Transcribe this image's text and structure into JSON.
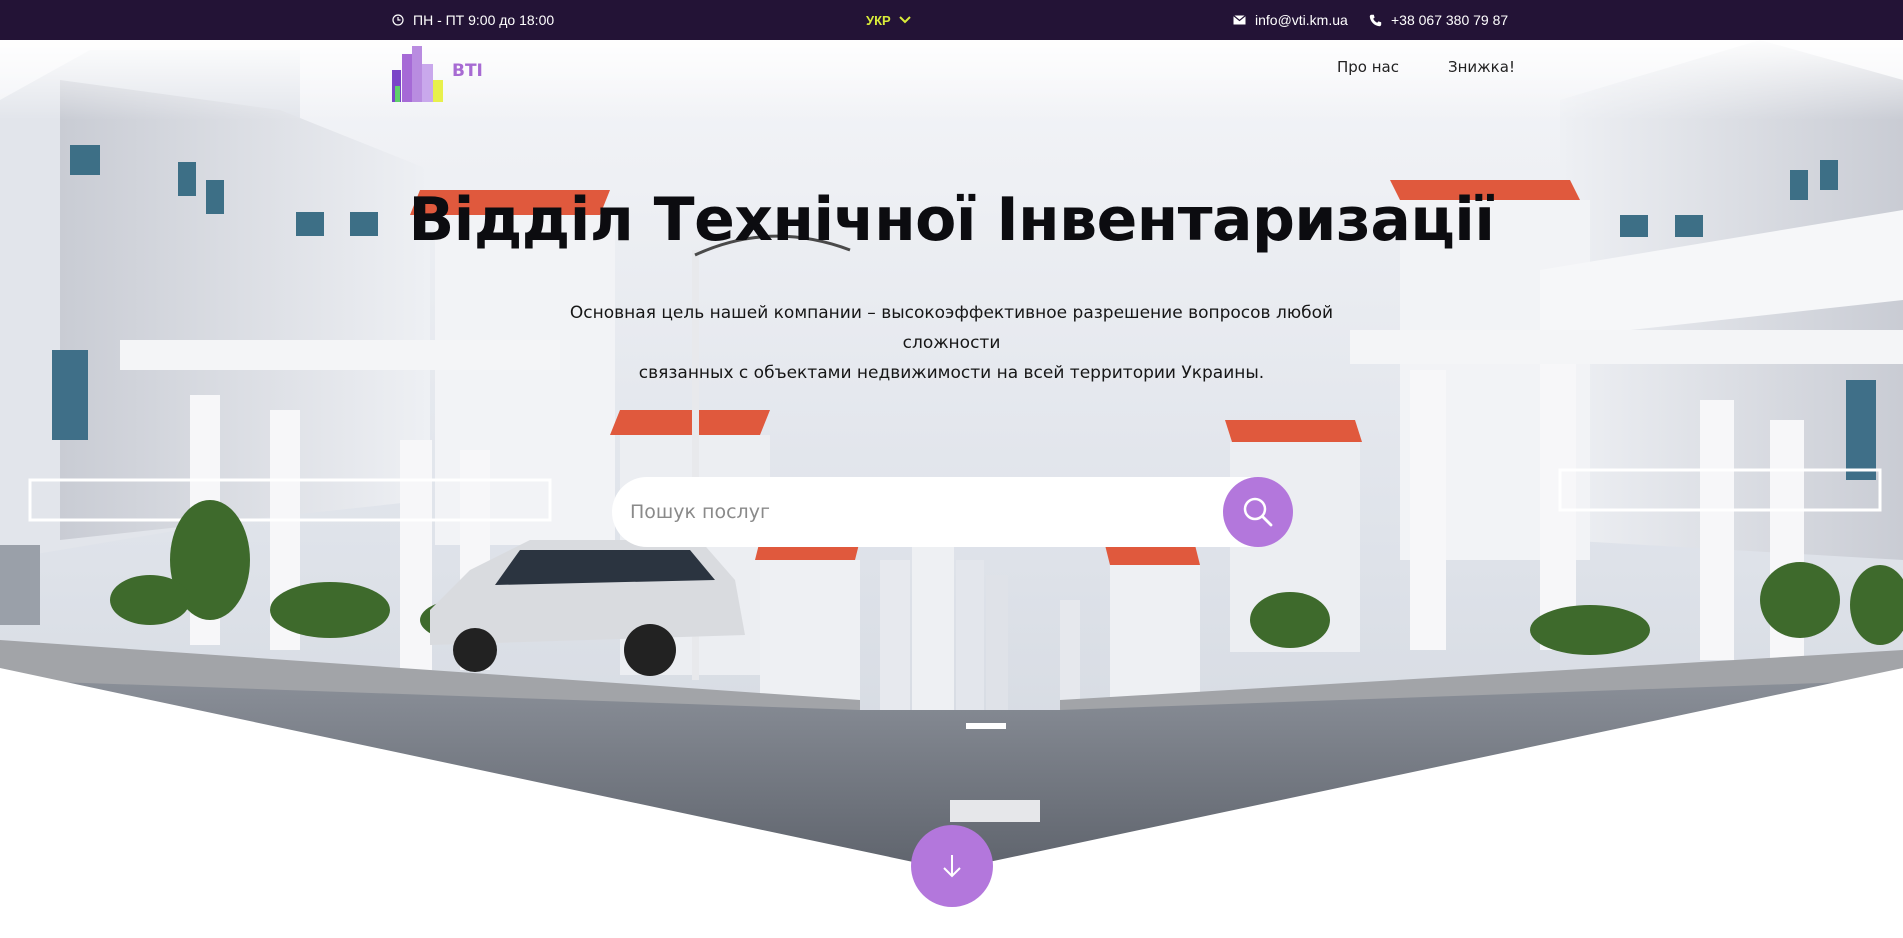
{
  "topbar": {
    "hours": "ПН - ПТ 9:00 до 18:00",
    "language": "УКР",
    "email": "info@vti.km.ua",
    "phone": "+38 067 380 79 87"
  },
  "header": {
    "logo_text": "BTI",
    "nav": [
      "Про нас",
      "Знижка!"
    ]
  },
  "hero": {
    "title": "Відділ Технічної Інвентаризації",
    "subtitle_line1": "Основная цель нашей компании – высокоэффективное разрешение вопросов любой сложности",
    "subtitle_line2": "связанных с объектами недвижимости на всей территории Украины."
  },
  "search": {
    "placeholder": "Пошук послуг"
  },
  "icons": {
    "hours": "clock-icon",
    "language": "chevron-down-icon",
    "email": "envelope-icon",
    "phone": "phone-icon",
    "search": "search-icon",
    "scroll": "arrow-down-icon"
  },
  "colors": {
    "topbar_bg": "#231336",
    "accent": "#b377dc",
    "language_accent": "#d9ec3a",
    "logo_text": "#a76bd3"
  }
}
